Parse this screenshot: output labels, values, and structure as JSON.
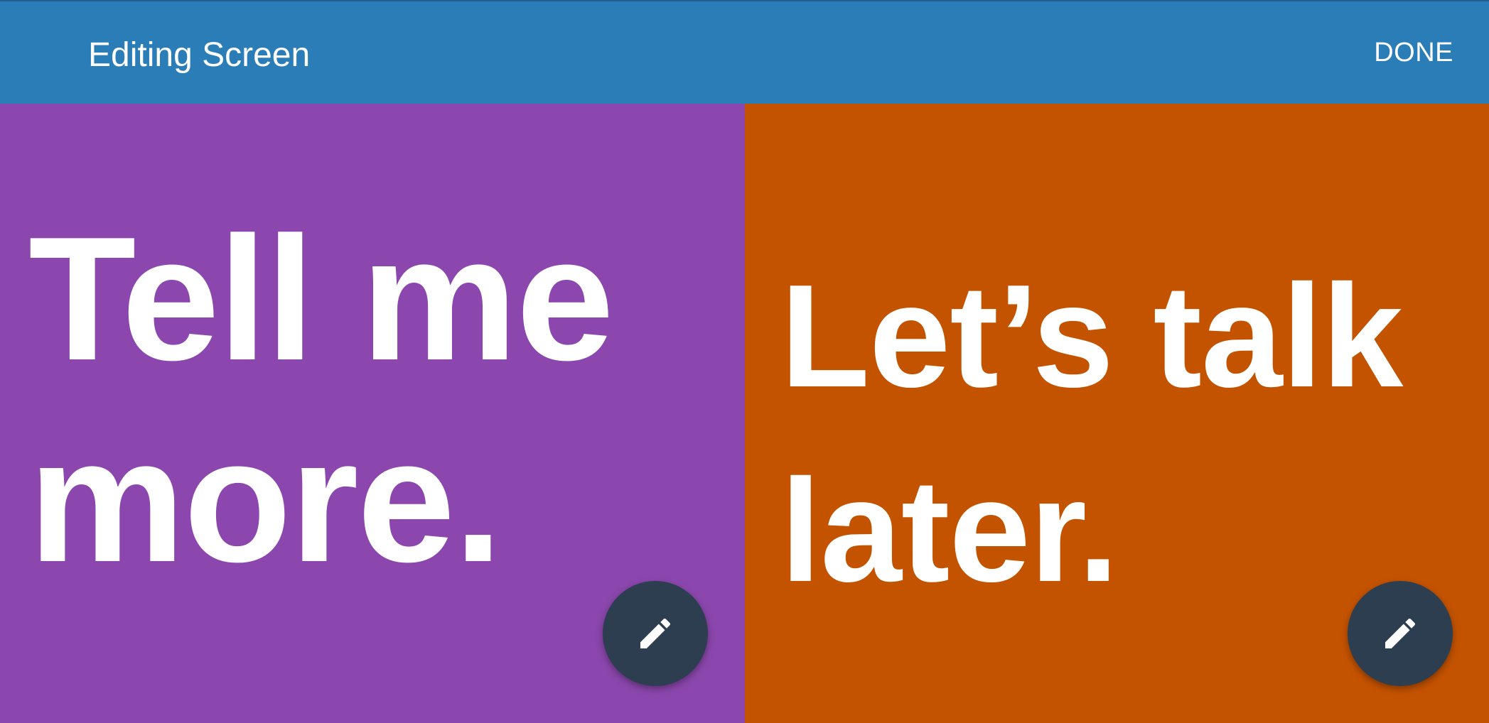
{
  "appbar": {
    "title": "Editing Screen",
    "done_label": "DONE",
    "color": "#2a7db6"
  },
  "panels": [
    {
      "text": "Tell me more.",
      "background": "#8b47ad",
      "edit_icon": "pencil-icon"
    },
    {
      "text": "Let’s talk later.",
      "background": "#c45300",
      "edit_icon": "pencil-icon"
    }
  ],
  "fab": {
    "color": "#2c3e50",
    "icon_color": "#ffffff"
  }
}
